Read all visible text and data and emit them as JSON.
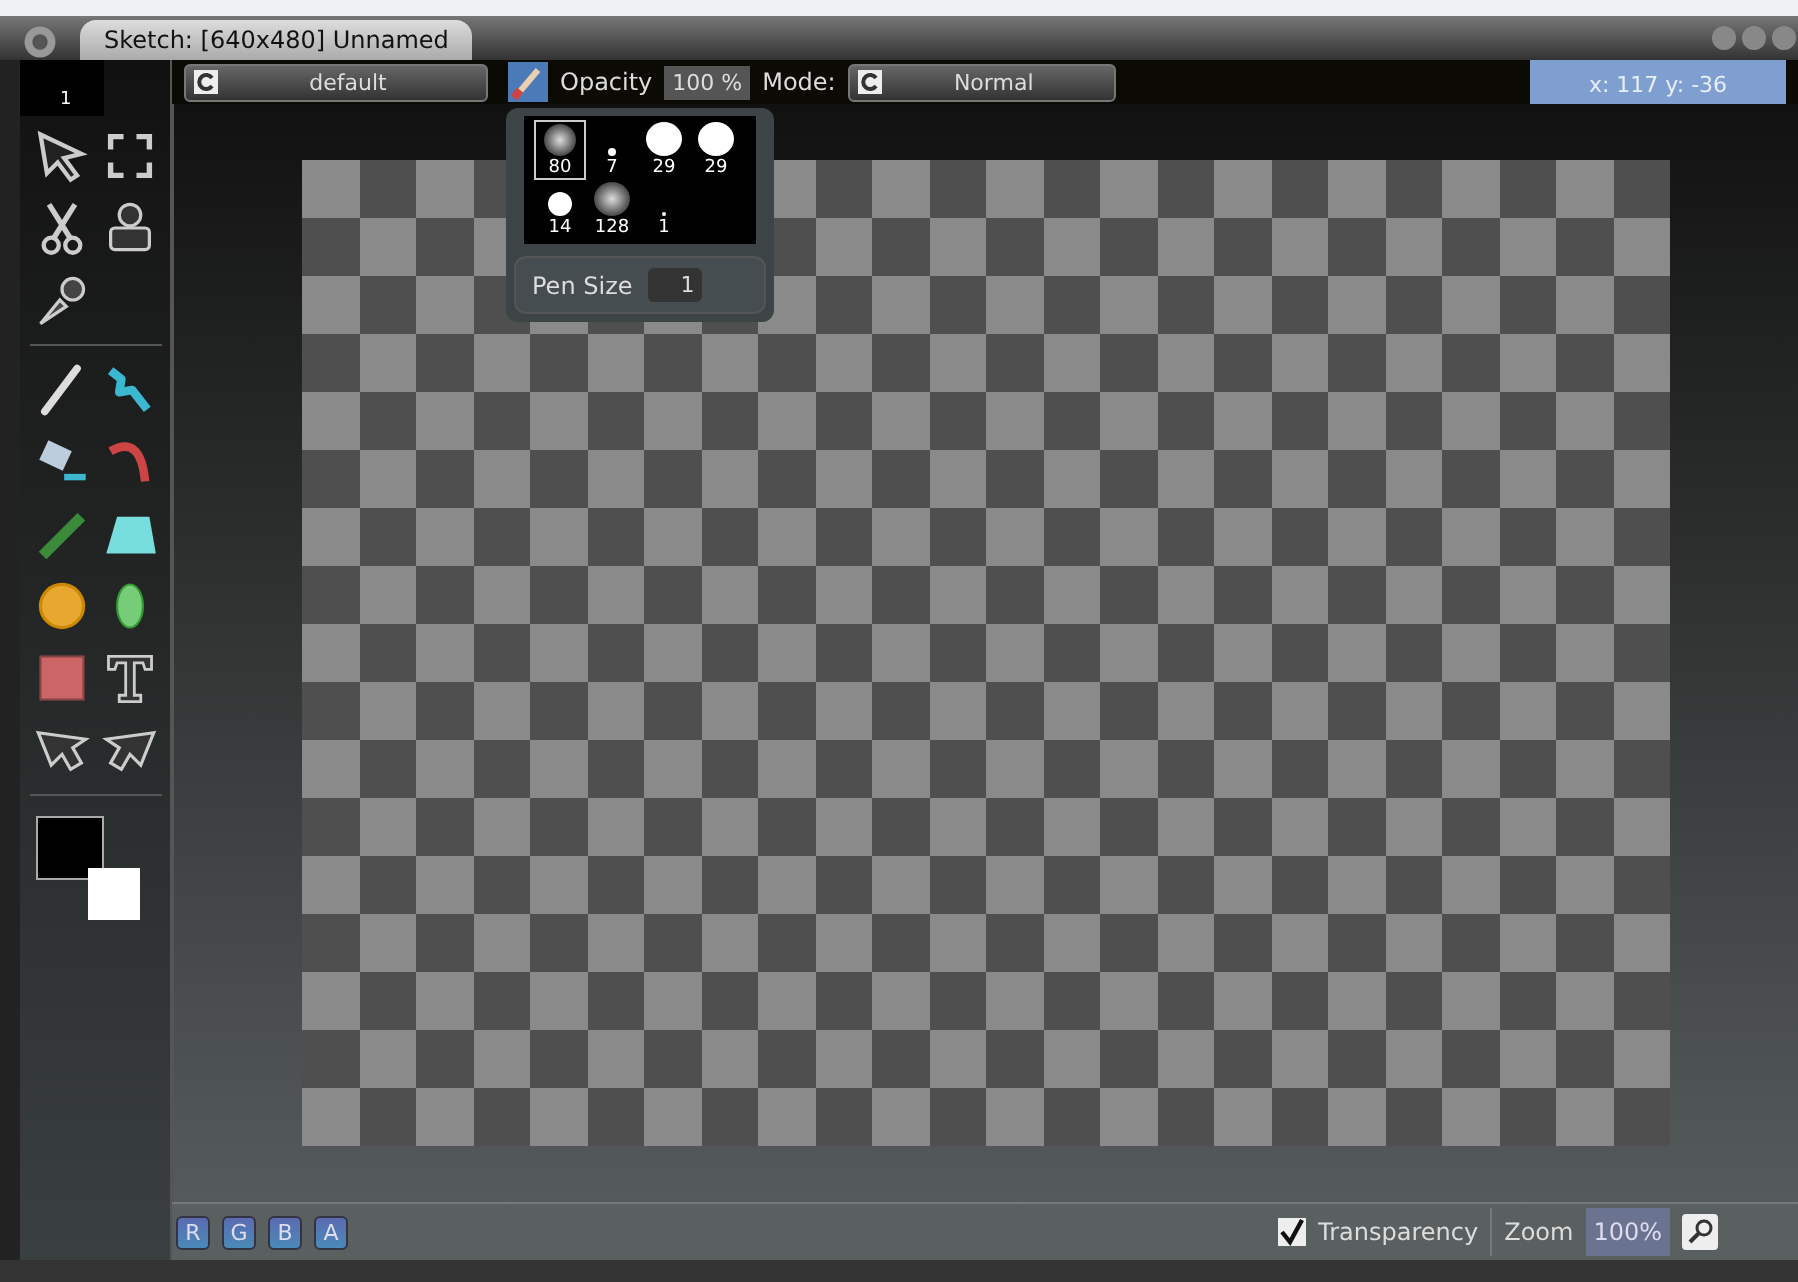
{
  "window": {
    "title": "Sketch: [640x480] Unnamed"
  },
  "toolbar": {
    "brush_number": "1",
    "preset": "default",
    "opacity_label": "Opacity",
    "opacity": "100 %",
    "mode_label": "Mode:",
    "mode": "Normal",
    "coordinates": "x: 117 y: -36"
  },
  "brushes": [
    {
      "size": "80",
      "kind": "soft",
      "selected": true
    },
    {
      "size": "7",
      "kind": "hard",
      "selected": false
    },
    {
      "size": "29",
      "kind": "hard",
      "selected": false
    },
    {
      "size": "29",
      "kind": "hard",
      "selected": false
    },
    {
      "size": "14",
      "kind": "hard",
      "selected": false
    },
    {
      "size": "128",
      "kind": "soft",
      "selected": false
    },
    {
      "size": "1",
      "kind": "hard",
      "selected": false
    }
  ],
  "pen_size": {
    "label": "Pen Size",
    "value": "1"
  },
  "channels": [
    "R",
    "G",
    "B",
    "A"
  ],
  "status_bar": {
    "transparency": {
      "label": "Transparency",
      "checked": true
    },
    "zoom_label": "Zoom",
    "zoom": "100%"
  }
}
